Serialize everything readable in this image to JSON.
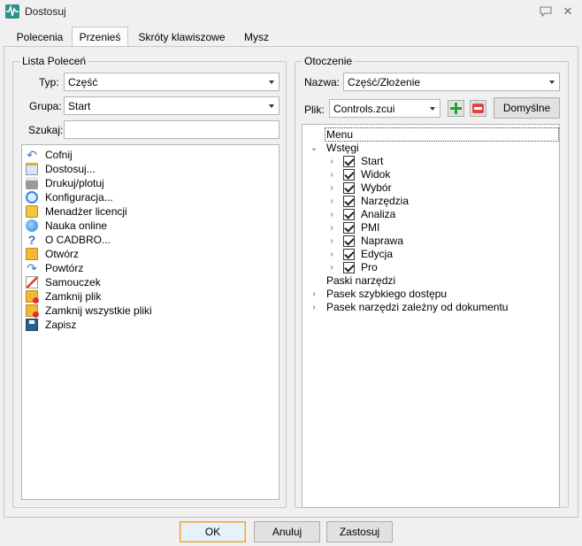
{
  "window": {
    "title": "Dostosuj",
    "icon": "app-waveform-icon"
  },
  "tabs": [
    {
      "label": "Polecenia"
    },
    {
      "label": "Przenieś",
      "active": true
    },
    {
      "label": "Skróty klawiszowe"
    },
    {
      "label": "Mysz"
    }
  ],
  "left_group": {
    "legend": "Lista Poleceń",
    "type_label": "Typ:",
    "type_value": "Część",
    "group_label": "Grupa:",
    "group_value": "Start",
    "search_label": "Szukaj:",
    "search_value": "",
    "commands": [
      {
        "label": "Cofnij",
        "icon": "undo-icon"
      },
      {
        "label": "Dostosuj...",
        "icon": "customize-icon"
      },
      {
        "label": "Drukuj/plotuj",
        "icon": "printer-icon"
      },
      {
        "label": "Konfiguracja...",
        "icon": "gear-icon"
      },
      {
        "label": "Menadżer licencji",
        "icon": "license-icon"
      },
      {
        "label": "Nauka online",
        "icon": "globe-icon"
      },
      {
        "label": "O CADBRO...",
        "icon": "question-icon"
      },
      {
        "label": "Otwórz",
        "icon": "open-folder-icon"
      },
      {
        "label": "Powtórz",
        "icon": "redo-icon"
      },
      {
        "label": "Samouczek",
        "icon": "tutorial-icon"
      },
      {
        "label": "Zamknij plik",
        "icon": "close-file-icon"
      },
      {
        "label": "Zamknij wszystkie pliki",
        "icon": "close-all-files-icon"
      },
      {
        "label": "Zapisz",
        "icon": "save-icon"
      }
    ]
  },
  "right_group": {
    "legend": "Otoczenie",
    "name_label": "Nazwa:",
    "name_value": "Część/Złożenie",
    "file_label": "Plik:",
    "file_value": "Controls.zcui",
    "default_button": "Domyślne",
    "tree": {
      "menu": "Menu",
      "ribbons": "Wstęgi",
      "ribbon_items": [
        "Start",
        "Widok",
        "Wybór",
        "Narzędzia",
        "Analiza",
        "PMI",
        "Naprawa",
        "Edycja",
        "Pro"
      ],
      "toolbars": "Paski narzędzi",
      "quick_access": "Pasek szybkiego dostępu",
      "doc_toolbar": "Pasek narzędzi zależny od dokumentu"
    }
  },
  "footer": {
    "ok": "OK",
    "cancel": "Anuluj",
    "apply": "Zastosuj"
  }
}
